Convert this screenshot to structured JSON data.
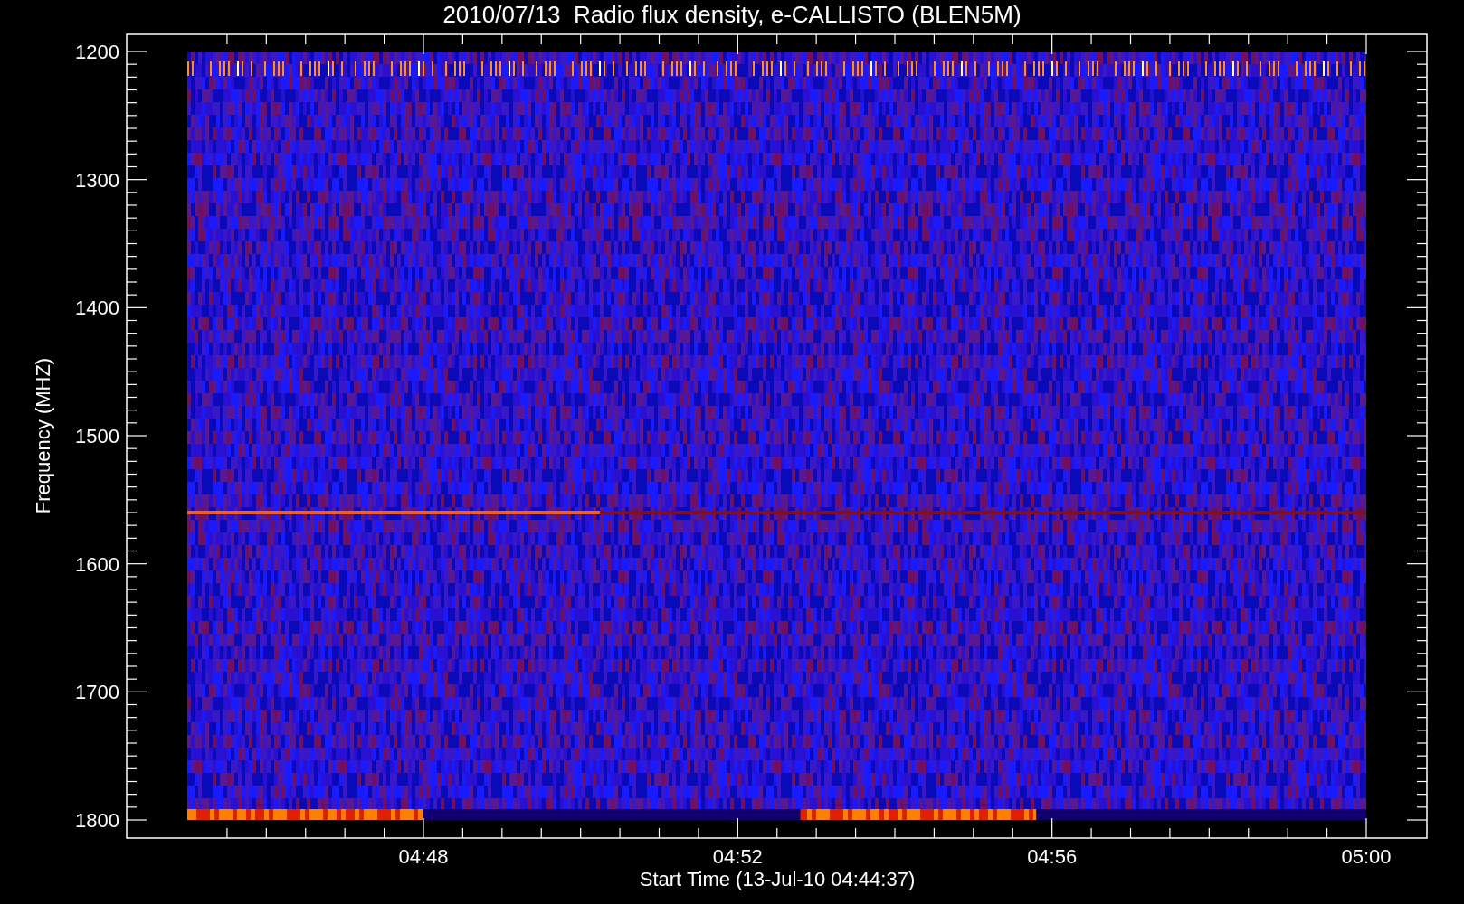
{
  "title": "2010/07/13  Radio flux density, e-CALLISTO (BLEN5M)",
  "y_axis": {
    "label": "Frequency (MHZ)",
    "ticks": [
      "1200",
      "1300",
      "1400",
      "1500",
      "1600",
      "1700",
      "1800"
    ]
  },
  "x_axis": {
    "label": "Start Time (13-Jul-10 04:44:37)",
    "ticks": [
      "04:48",
      "04:52",
      "04:56",
      "05:00"
    ]
  }
}
